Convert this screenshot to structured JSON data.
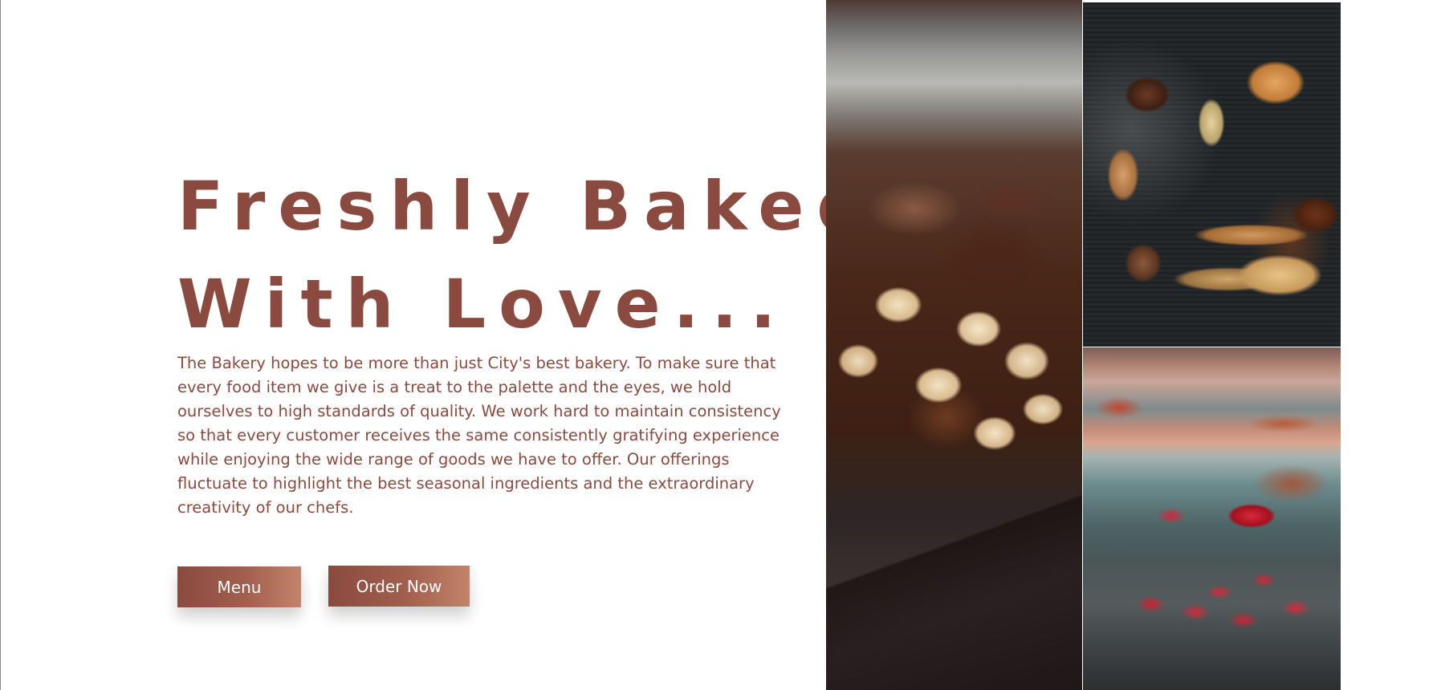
{
  "hero": {
    "headline_line1": "Freshly Baked",
    "headline_line2": "With Love...",
    "description": "The Bakery hopes to be more than just City's best bakery. To make sure that every food item we give is a treat to the palette and the eyes, we hold ourselves to high standards of quality. We work hard to maintain consistency so that every customer receives the same consistently gratifying experience while enjoying the wide range of goods we have to offer. Our offerings fluctuate to highlight the best seasonal ingredients and the extraordinary creativity of our chefs."
  },
  "buttons": {
    "menu_label": "Menu",
    "order_label": "Order Now"
  },
  "colors": {
    "accent": "#8b4a3f",
    "button_gradient_end": "#c3836a",
    "background": "#ffffff"
  }
}
